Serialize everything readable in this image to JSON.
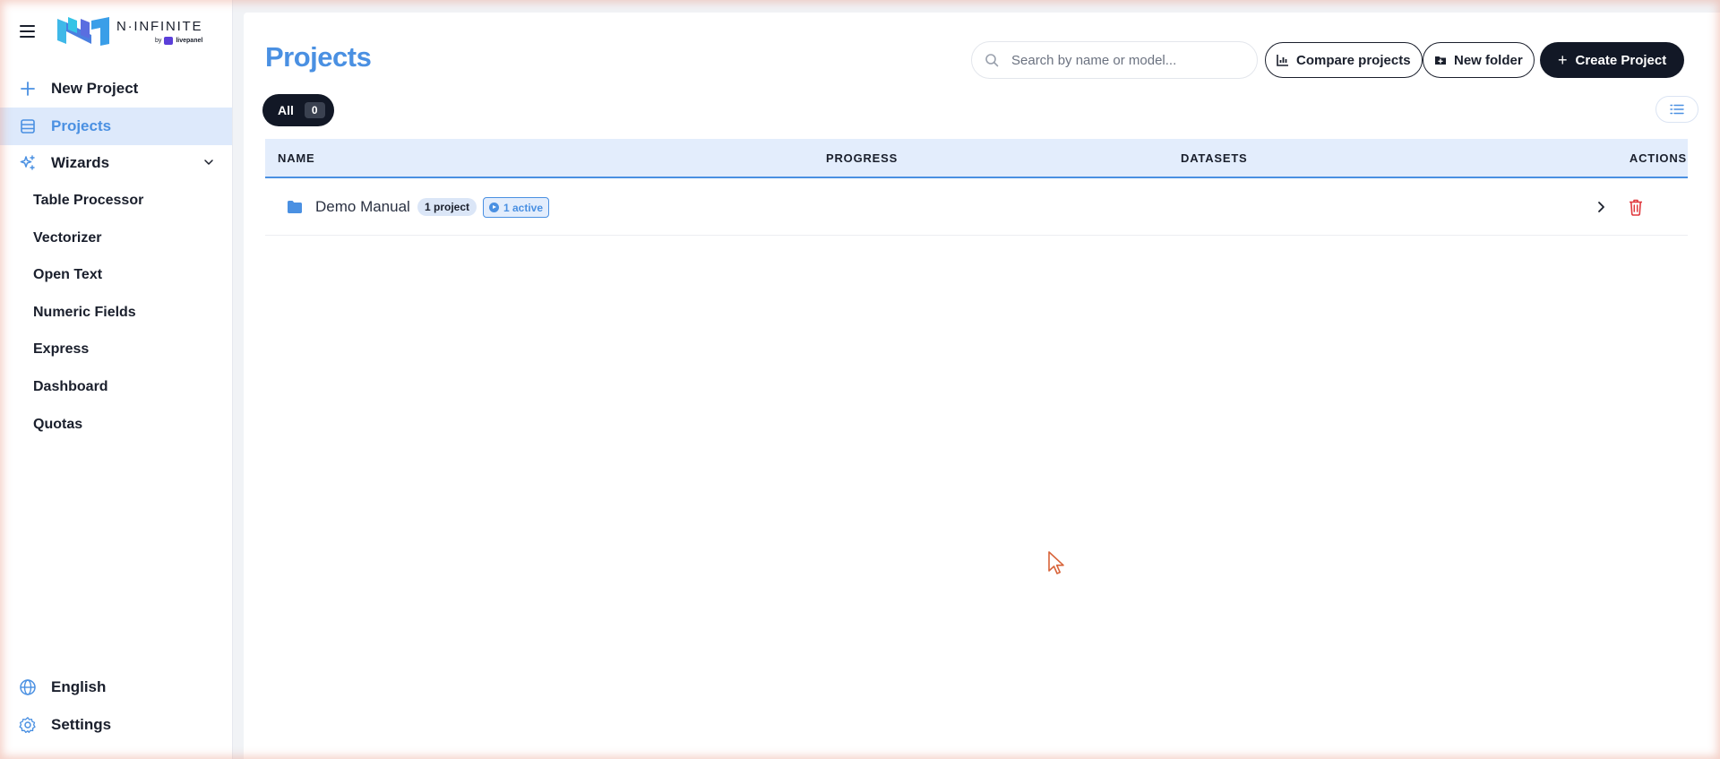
{
  "brand": {
    "name": "N·INFINITE",
    "by_label": "by",
    "by_brand": "livepanel"
  },
  "sidebar": {
    "new_project": {
      "label": "New Project",
      "icon": "plus-icon"
    },
    "projects": {
      "label": "Projects",
      "icon": "table-icon",
      "active": true
    },
    "wizards": {
      "label": "Wizards",
      "icon": "sparkles-icon",
      "expanded": true
    },
    "wizard_items": [
      {
        "label": "Table Processor"
      },
      {
        "label": "Vectorizer"
      },
      {
        "label": "Open Text"
      },
      {
        "label": "Numeric Fields"
      },
      {
        "label": "Express"
      },
      {
        "label": "Dashboard"
      },
      {
        "label": "Quotas"
      }
    ],
    "language": {
      "label": "English",
      "icon": "globe-icon"
    },
    "settings": {
      "label": "Settings",
      "icon": "gear-icon"
    }
  },
  "header": {
    "title": "Projects",
    "search_placeholder": "Search by name or model...",
    "search_value": "",
    "compare_label": "Compare projects",
    "new_folder_label": "New folder",
    "create_label": "Create Project"
  },
  "filters": {
    "all_label": "All",
    "all_count": "0"
  },
  "table": {
    "columns": [
      "NAME",
      "PROGRESS",
      "DATASETS",
      "ACTIONS"
    ],
    "rows": [
      {
        "name": "Demo Manual",
        "type": "folder",
        "project_count": "1 project",
        "active_label": "1 active"
      }
    ]
  },
  "colors": {
    "accent": "#4a90e2",
    "primary_dark": "#121826",
    "active_bg": "#dde9fb",
    "danger": "#e0393e"
  }
}
